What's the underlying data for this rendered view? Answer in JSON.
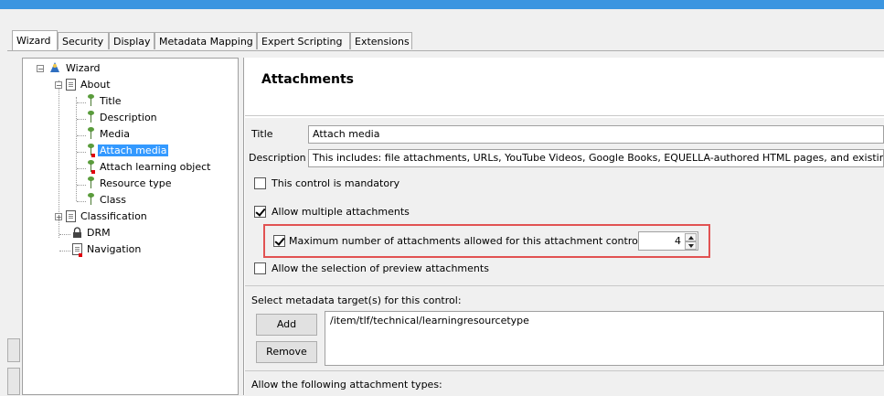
{
  "tabs": [
    "Wizard",
    "Security",
    "Display",
    "Metadata Mapping",
    "Expert Scripting",
    "Extensions"
  ],
  "tree": {
    "root": "Wizard",
    "about": "About",
    "about_children": [
      "Title",
      "Description",
      "Media",
      "Attach media",
      "Attach learning object",
      "Resource type",
      "Class"
    ],
    "classification": "Classification",
    "drm": "DRM",
    "navigation": "Navigation",
    "selected": "Attach media"
  },
  "panel": {
    "heading": "Attachments",
    "title_label": "Title",
    "title_value": "Attach media",
    "description_label": "Description",
    "description_value": "This includes: file attachments, URLs, YouTube Videos, Google Books, EQUELLA-authored HTML pages, and existing",
    "mandatory_label": "This control is mandatory",
    "mandatory_checked": false,
    "allow_multiple_label": "Allow multiple attachments",
    "allow_multiple_checked": true,
    "max_label": "Maximum number of attachments allowed for this attachment control",
    "max_checked": true,
    "max_value": "4",
    "preview_label": "Allow the selection of preview attachments",
    "preview_checked": false,
    "metadata_label": "Select metadata target(s) for this control:",
    "add_label": "Add",
    "remove_label": "Remove",
    "metadata_targets": [
      "/item/tlf/technical/learningresourcetype"
    ],
    "attachment_types_label": "Allow the following attachment types:"
  },
  "colors": {
    "titlebar": "#3b95e0",
    "highlight": "#e15252",
    "selection": "#3399ff",
    "required_marker": "#e0000f"
  }
}
